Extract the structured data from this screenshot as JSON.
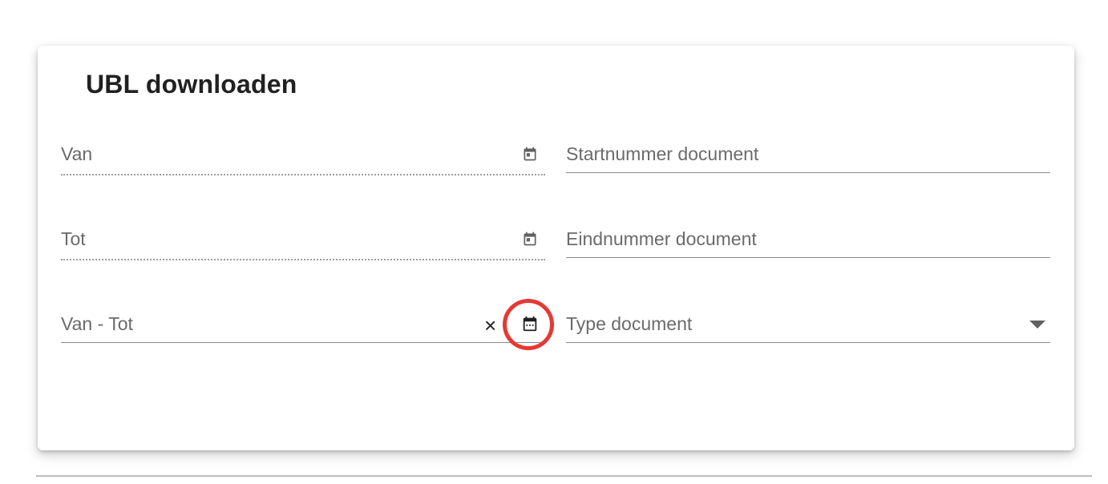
{
  "card": {
    "title": "UBL downloaden"
  },
  "left_fields": [
    {
      "label": "Van",
      "icon": "calendar-icon"
    },
    {
      "label": "Tot",
      "icon": "calendar-icon"
    },
    {
      "label": "Van - Tot",
      "icon": "calendar-range-icon",
      "clear": "×"
    }
  ],
  "right_fields": [
    {
      "label": "Startnummer document"
    },
    {
      "label": "Eindnummer document"
    },
    {
      "label": "Type document",
      "icon": "arrow-drop-down-icon"
    }
  ],
  "colors": {
    "highlight": "#e53935",
    "label": "#6b6b6b",
    "icon": "#616161"
  }
}
